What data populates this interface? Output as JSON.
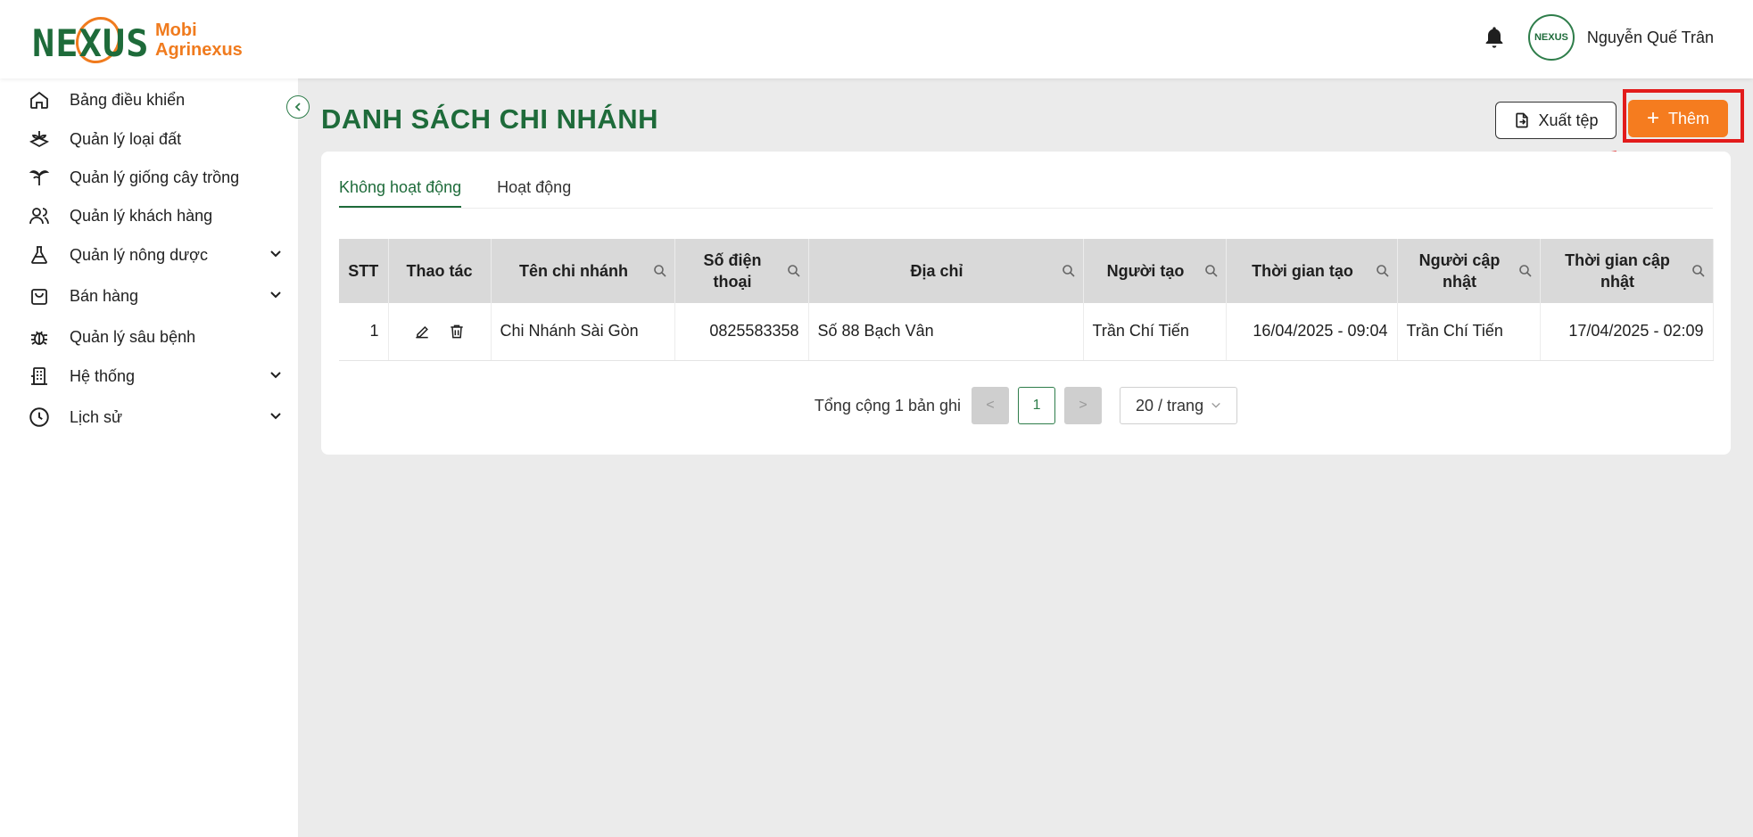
{
  "brand": {
    "logo_mark": "NEXUS",
    "name_line1": "Mobi",
    "name_line2": "Agrinexus"
  },
  "header": {
    "user_name": "Nguyễn Quế Trân",
    "avatar_text": "NEXUS"
  },
  "sidebar": {
    "items": [
      {
        "label": "Bảng điều khiển",
        "icon": "home-icon"
      },
      {
        "label": "Quản lý loại đất",
        "icon": "soil-icon"
      },
      {
        "label": "Quản lý giống cây trồng",
        "icon": "plant-icon"
      },
      {
        "label": "Quản lý khách hàng",
        "icon": "users-icon"
      },
      {
        "label": "Quản lý nông dược",
        "icon": "flask-icon",
        "expandable": true
      },
      {
        "label": "Bán hàng",
        "icon": "shopping-bag-icon",
        "expandable": true
      },
      {
        "label": "Quản lý sâu bệnh",
        "icon": "bug-icon"
      },
      {
        "label": "Hệ thống",
        "icon": "building-icon",
        "expandable": true
      },
      {
        "label": "Lịch sử",
        "icon": "clock-icon",
        "expandable": true
      }
    ]
  },
  "page": {
    "title": "DANH SÁCH CHI NHÁNH",
    "export_label": "Xuất tệp",
    "add_label": "Thêm"
  },
  "tabs": [
    {
      "label": "Không hoạt động",
      "active": true
    },
    {
      "label": "Hoạt động",
      "active": false
    }
  ],
  "table": {
    "headers": {
      "stt": "STT",
      "actions": "Thao tác",
      "branch_name": "Tên chi nhánh",
      "phone_line1": "Số điện",
      "phone_line2": "thoại",
      "address": "Địa chỉ",
      "creator": "Người tạo",
      "created_at": "Thời gian tạo",
      "updater_line1": "Người cập",
      "updater_line2": "nhật",
      "updated_at_line1": "Thời gian cập",
      "updated_at_line2": "nhật"
    },
    "rows": [
      {
        "stt": "1",
        "branch_name": "Chi Nhánh Sài Gòn",
        "phone": "0825583358",
        "address": "Số 88 Bạch Vân",
        "creator": "Trần Chí Tiến",
        "created_at": "16/04/2025 - 09:04",
        "updater": "Trần Chí Tiến",
        "updated_at": "17/04/2025 - 02:09"
      }
    ]
  },
  "pagination": {
    "total_text": "Tổng cộng 1 bản ghi",
    "current_page": "1",
    "page_size": "20 / trang",
    "prev": "<",
    "next": ">"
  },
  "colors": {
    "primary": "#1e6b3a",
    "accent": "#f57c1f",
    "highlight": "#e21b1b"
  }
}
